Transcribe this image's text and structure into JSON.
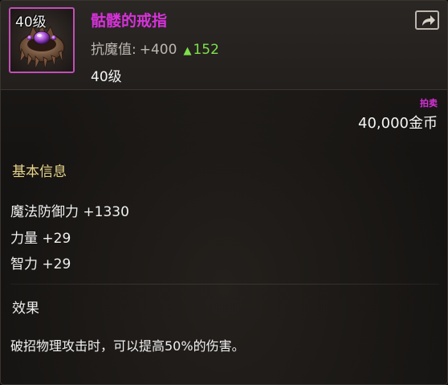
{
  "item": {
    "level_badge": "40级",
    "name": "骷髅的戒指",
    "stat_label": "抗魔值:",
    "stat_value": "+400",
    "stat_bonus": "152",
    "required_level": "40级",
    "icon": "crown-ring-icon"
  },
  "share": {
    "icon": "share-icon"
  },
  "price": {
    "tag": "拍卖",
    "amount": "40,000金币"
  },
  "basic_info": {
    "title": "基本信息",
    "attributes": [
      "魔法防御力 +1330",
      "力量 +29",
      "智力 +29"
    ]
  },
  "effect": {
    "title": "效果",
    "description": "破招物理攻击时，可以提高50%的伤害。"
  },
  "colors": {
    "name": "#d632d9",
    "bonus": "#7fe04a",
    "section_title": "#e9d48a",
    "frame": "#c24fb6"
  }
}
